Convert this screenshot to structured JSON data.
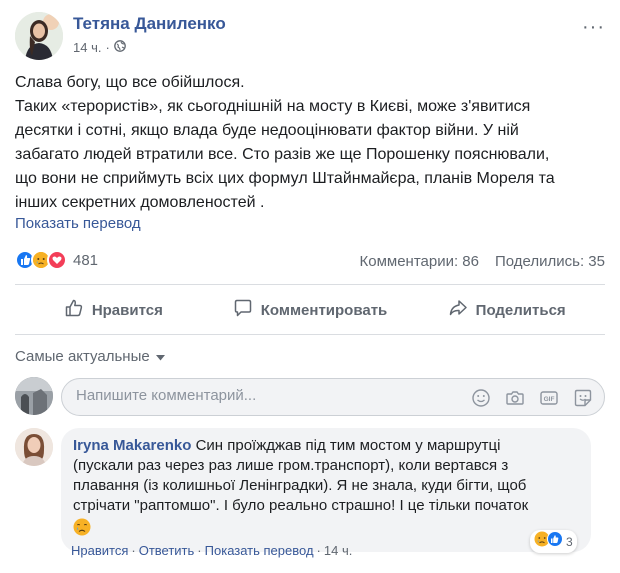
{
  "post": {
    "author": "Тетяна Даниленко",
    "time": "14 ч.",
    "more_label": "···",
    "lines": [
      "Слава богу, що все обійшлося.",
      "Таких «терористів», як сьогоднішній на мосту в Києві, може з'явитися",
      "десятки і сотні, якщо влада буде недооцінювати фактор війни. У ній",
      "забагато людей втратили все. Сто разів же ще Порошенку пояснювали,",
      "що вони не сприймуть всіх цих формул Штайнмайєра, планів Мореля та",
      "інших секретних домовленостей ."
    ],
    "translate": "Показать перевод"
  },
  "stats": {
    "reactions_count": "481",
    "comments": "Комментарии: 86",
    "shares": "Поделились: 35"
  },
  "actions": {
    "like": "Нравится",
    "comment": "Комментировать",
    "share": "Поделиться"
  },
  "comments_section": {
    "sort_label": "Самые актуальные",
    "placeholder": "Напишите комментарий..."
  },
  "comment": {
    "author": "Iryna Makarenko",
    "lines": [
      "Син проїжджав під тим мостом у маршрутці",
      "(пускали раз через раз лише гром.транспорт), коли вертався з",
      "плавання (із колишньої Ленінградки). Я не знала, куди бігти, щоб",
      "стрічати \"раптомшо\". І було реально страшно! І це тільки початок"
    ],
    "reactions_count": "3",
    "actions": {
      "like": "Нравится",
      "reply": "Ответить",
      "translate": "Показать перевод",
      "time": "14 ч."
    }
  },
  "colors": {
    "link": "#385898",
    "muted": "#606770",
    "like_blue": "#1877f2",
    "love_red": "#f33e58",
    "sad_yellow": "#f7b125"
  }
}
